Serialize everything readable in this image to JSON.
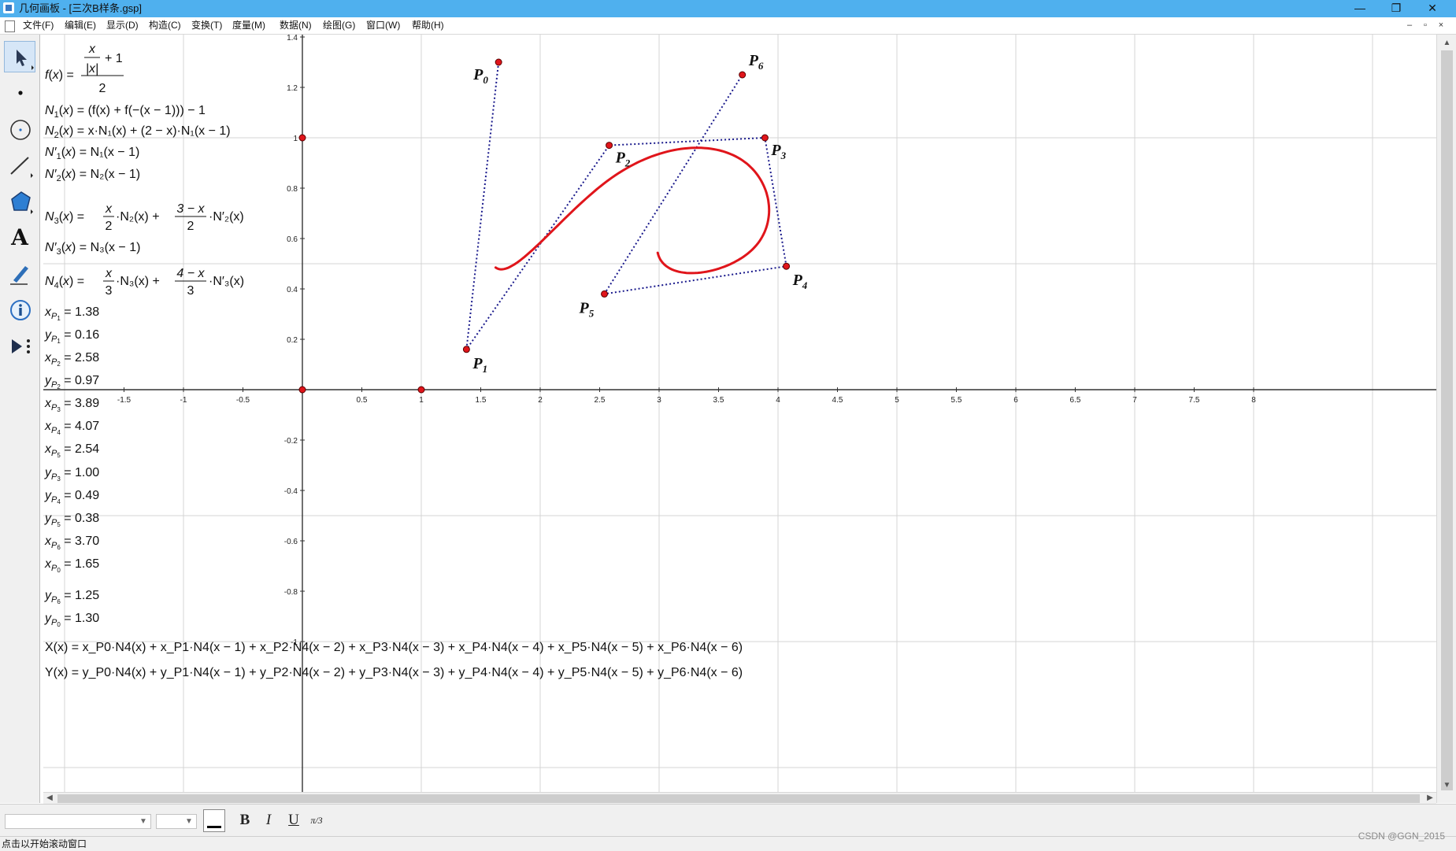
{
  "window": {
    "title": "几何画板 - [三次B样条.gsp]",
    "minimize": "—",
    "restore": "❐",
    "close": "✕"
  },
  "menu": {
    "items": [
      "文件(F)",
      "编辑(E)",
      "显示(D)",
      "构造(C)",
      "变换(T)",
      "度量(M)",
      "数据(N)",
      "绘图(G)",
      "窗口(W)",
      "帮助(H)"
    ],
    "mdi_minimize": "–",
    "mdi_restore": "▫",
    "mdi_close": "×"
  },
  "toolbox": {
    "tools": [
      "arrow-select-tool-icon",
      "point-tool-icon",
      "compass-tool-icon",
      "straightedge-tool-icon",
      "polygon-tool-icon",
      "text-tool-icon",
      "marker-tool-icon",
      "information-tool-icon",
      "custom-tool-icon"
    ],
    "text_tool_label": "A"
  },
  "graph": {
    "x_ticks": [
      "-1.5",
      "-1",
      "-0.5",
      "0.5",
      "1",
      "1.5",
      "2",
      "2.5",
      "3",
      "3.5",
      "4",
      "4.5",
      "5",
      "5.5",
      "6",
      "6.5",
      "7",
      "7.5",
      "8"
    ],
    "y_ticks_pos": [
      "0.2",
      "0.4",
      "0.6",
      "0.8",
      "1",
      "1.2",
      "1.4"
    ],
    "y_ticks_neg": [
      "-0.2",
      "-0.4",
      "-0.6",
      "-0.8",
      "-1"
    ],
    "unit_points": [
      "(0,0)",
      "(1,0)",
      "(0,1)"
    ],
    "control_points": [
      {
        "label": "P",
        "sub": "0",
        "x": 1.65,
        "y": 1.3
      },
      {
        "label": "P",
        "sub": "1",
        "x": 1.38,
        "y": 0.16
      },
      {
        "label": "P",
        "sub": "2",
        "x": 2.58,
        "y": 0.97
      },
      {
        "label": "P",
        "sub": "3",
        "x": 3.89,
        "y": 1.0
      },
      {
        "label": "P",
        "sub": "4",
        "x": 4.07,
        "y": 0.49
      },
      {
        "label": "P",
        "sub": "5",
        "x": 2.54,
        "y": 0.38
      },
      {
        "label": "P",
        "sub": "6",
        "x": 3.7,
        "y": 1.25
      }
    ],
    "control_polygon_order": [
      0,
      1,
      2,
      3,
      4,
      5,
      6
    ],
    "curve_color": "#e0151b",
    "polygon_color": "#1a1a8c",
    "point_color": "#e0151b"
  },
  "formulas": {
    "f": {
      "lhs": "f(x) =",
      "num_top": "x",
      "num_den": "|x|",
      "plus_one": "+ 1",
      "den": "2"
    },
    "N1": "= (f(x) + f(−(x − 1))) − 1",
    "N2": "= x·N₁(x) + (2 − x)·N₁(x − 1)",
    "N1p": "= N₁(x − 1)",
    "N2p": "= N₂(x − 1)",
    "N3": {
      "frac1_num": "x",
      "frac1_den": "2",
      "mid": "·N₂(x) +",
      "frac2_num": "3 − x",
      "frac2_den": "2",
      "tail": "·N′₂(x)"
    },
    "N3p": "= N₃(x − 1)",
    "N4": {
      "frac1_num": "x",
      "frac1_den": "3",
      "mid": "·N₃(x) +",
      "frac2_num": "4 − x",
      "frac2_den": "3",
      "tail": "·N′₃(x)"
    },
    "measurements": [
      {
        "name": "x",
        "sub": "P",
        "subsub": "1",
        "value": "= 1.38"
      },
      {
        "name": "y",
        "sub": "P",
        "subsub": "1",
        "value": "= 0.16"
      },
      {
        "name": "x",
        "sub": "P",
        "subsub": "2",
        "value": "= 2.58"
      },
      {
        "name": "y",
        "sub": "P",
        "subsub": "2",
        "value": "= 0.97"
      },
      {
        "name": "x",
        "sub": "P",
        "subsub": "3",
        "value": "= 3.89"
      },
      {
        "name": "x",
        "sub": "P",
        "subsub": "4",
        "value": "= 4.07"
      },
      {
        "name": "x",
        "sub": "P",
        "subsub": "5",
        "value": "= 2.54"
      },
      {
        "name": "y",
        "sub": "P",
        "subsub": "3",
        "value": "= 1.00"
      },
      {
        "name": "y",
        "sub": "P",
        "subsub": "4",
        "value": "= 0.49"
      },
      {
        "name": "y",
        "sub": "P",
        "subsub": "5",
        "value": "= 0.38"
      },
      {
        "name": "x",
        "sub": "P",
        "subsub": "6",
        "value": "= 3.70"
      },
      {
        "name": "x",
        "sub": "P",
        "subsub": "0",
        "value": "= 1.65"
      },
      {
        "name": "y",
        "sub": "P",
        "subsub": "6",
        "value": "= 1.25"
      },
      {
        "name": "y",
        "sub": "P",
        "subsub": "0",
        "value": "= 1.30"
      }
    ],
    "X_def": "X(x) = x_P0·N4(x) + x_P1·N4(x − 1) + x_P2·N4(x − 2) + x_P3·N4(x − 3) + x_P4·N4(x − 4) + x_P5·N4(x − 5) + x_P6·N4(x − 6)",
    "Y_def": "Y(x) = y_P0·N4(x) + y_P1·N4(x − 1) + y_P2·N4(x − 2) + y_P3·N4(x − 3) + y_P4·N4(x − 4) + y_P5·N4(x − 5) + y_P6·N4(x − 6)"
  },
  "textbar": {
    "bold": "B",
    "italic": "I",
    "underline": "U",
    "math": "π/3"
  },
  "status": {
    "text": "点击以开始滚动窗口"
  },
  "watermark": "CSDN @GGN_2015"
}
